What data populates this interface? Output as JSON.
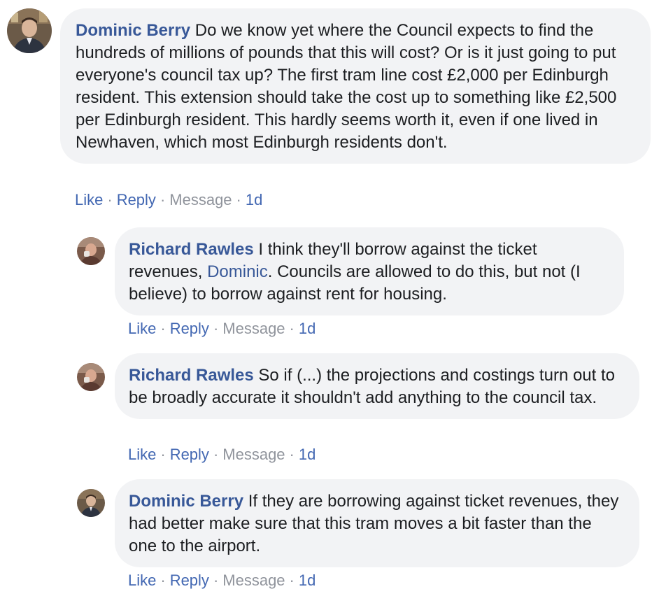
{
  "comments": [
    {
      "author": "Dominic Berry",
      "text": " Do we know yet where the Council expects to find the hundreds of millions of pounds that this will cost? Or is it just going to put everyone's council tax up? The first tram line cost £2,000 per Edinburgh resident. This extension should take the cost up to something like £2,500 per Edinburgh resident. This hardly seems worth it, even if one lived in Newhaven, which most Edinburgh residents don't.",
      "actions": {
        "like": "Like",
        "reply": "Reply",
        "message": "Message",
        "time": "1d",
        "sep": "·"
      }
    },
    {
      "author": "Richard Rawles",
      "text_before": " I think they'll borrow against the ticket revenues, ",
      "mention": "Dominic",
      "text_after": ". Councils are allowed to do this, but not (I believe) to borrow against rent for housing.",
      "actions": {
        "like": "Like",
        "reply": "Reply",
        "message": "Message",
        "time": "1d",
        "sep": "·"
      }
    },
    {
      "author": "Richard Rawles",
      "text": " So if (...) the projections and costings turn out to be broadly accurate it shouldn't add anything to the council tax.",
      "actions": {
        "like": "Like",
        "reply": "Reply",
        "message": "Message",
        "time": "1d",
        "sep": "·"
      }
    },
    {
      "author": "Dominic Berry",
      "text": " If they are borrowing against ticket revenues, they had better make sure that this tram moves a bit faster than the one to the airport.",
      "actions": {
        "like": "Like",
        "reply": "Reply",
        "message": "Message",
        "time": "1d",
        "sep": "·"
      }
    }
  ],
  "colors": {
    "author": "#385898",
    "link": "#4267b2",
    "muted": "#90949c",
    "bubble": "#f2f3f5"
  }
}
